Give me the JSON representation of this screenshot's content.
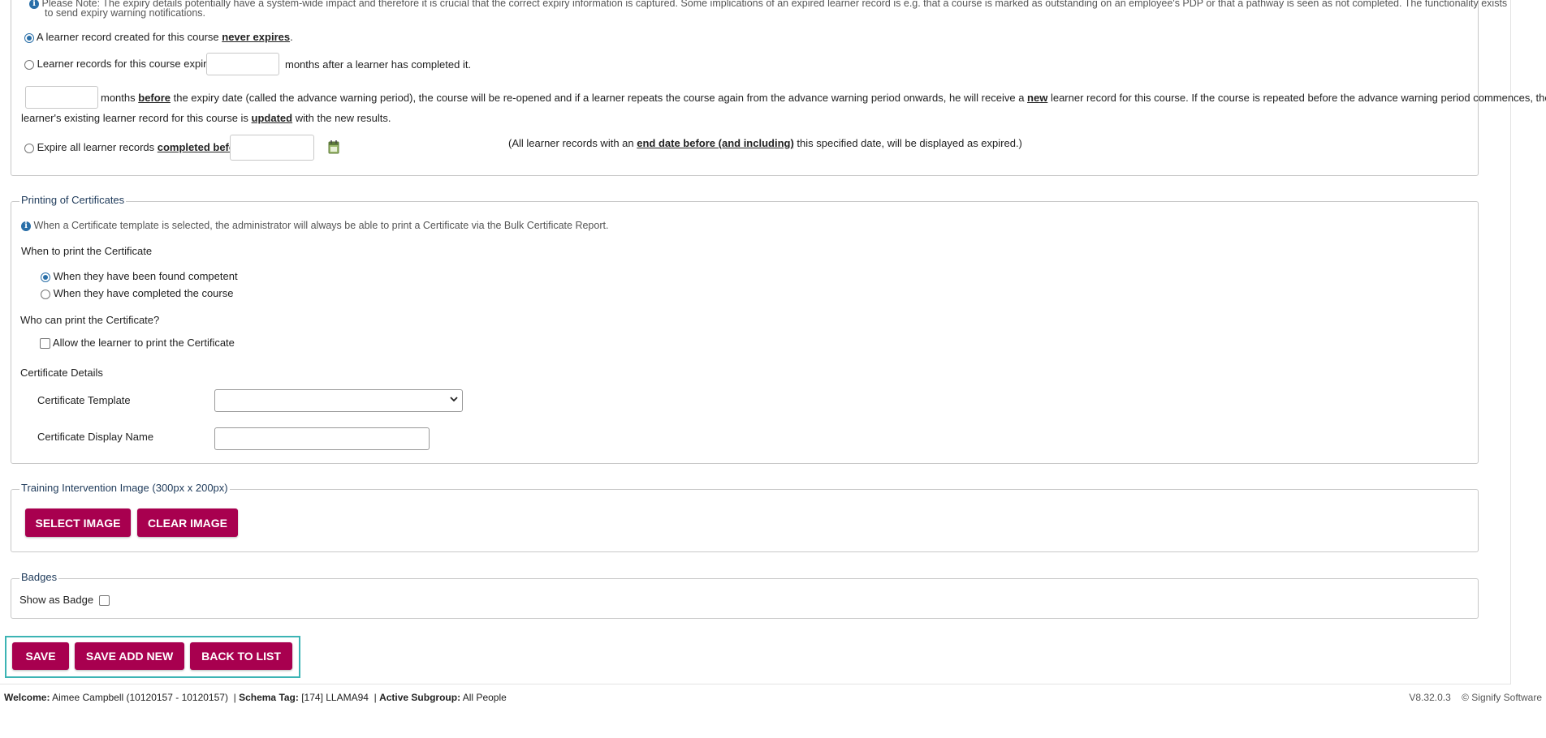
{
  "expiry": {
    "note": "Please Note: The expiry details potentially have a system-wide impact and therefore it is crucial that the correct expiry information is captured. Some implications of an expired learner record is e.g. that a course is marked as outstanding on an employee's PDP or that a pathway is seen as not completed. The functionality exists",
    "note_line2": "to send expiry warning notifications.",
    "option1_prefix": "A learner record created for this course ",
    "option1_emph": "never expires",
    "option1_suffix": ".",
    "option2_prefix": "Learner records for this course expire",
    "option2_suffix": "months after a learner has completed it.",
    "warning_a": "months ",
    "warning_b": "before",
    "warning_c": " the expiry date (called the advance warning period), the course will be re-opened and if a learner repeats the course again from the advance warning period onwards, he will receive a ",
    "warning_d": "new",
    "warning_e": " learner record for this course. If the course is repeated before the advance warning period commences, the",
    "warning_f": "learner's existing learner record for this course is ",
    "warning_g": "updated",
    "warning_h": " with the new results.",
    "option3_prefix": "Expire all learner records ",
    "option3_emph": "completed before",
    "option3_info_a": "(All learner records with an ",
    "option3_info_b": "end date before (and including)",
    "option3_info_c": " this specified date, will be displayed as expired.)",
    "months_value": "",
    "warning_value": "",
    "date_value": ""
  },
  "certificates": {
    "legend": "Printing of Certificates",
    "info": "When a Certificate template is selected, the administrator will always be able to print a Certificate via the Bulk Certificate Report.",
    "when_heading": "When to print the Certificate",
    "when_option1": "When they have been found competent",
    "when_option2": "When they have completed the course",
    "who_heading": "Who can print the Certificate?",
    "allow_learner": "Allow the learner to print the Certificate",
    "details_heading": "Certificate Details",
    "template_label": "Certificate Template",
    "template_value": "",
    "display_name_label": "Certificate Display Name",
    "display_name_value": ""
  },
  "image": {
    "legend": "Training Intervention Image (300px x 200px)",
    "select_label": "SELECT IMAGE",
    "clear_label": "CLEAR IMAGE"
  },
  "badges": {
    "legend": "Badges",
    "show_label": "Show as Badge"
  },
  "actions": {
    "save": "SAVE",
    "save_add_new": "SAVE ADD NEW",
    "back_to_list": "BACK TO LIST"
  },
  "footer": {
    "welcome_label": "Welcome:",
    "welcome_value": " Aimee Campbell (10120157 - 10120157)",
    "schema_label": "Schema Tag:",
    "schema_value": " [174] LLAMA94",
    "subgroup_label": "Active Subgroup:",
    "subgroup_value": " All People",
    "version": "V8.32.0.3",
    "copyright": "© Signify Software"
  },
  "colors": {
    "brand_button": "#a8004f",
    "legend_text": "#1e3a5a",
    "focus_frame": "#3cb4b4",
    "info_icon": "#2a6fa8"
  }
}
